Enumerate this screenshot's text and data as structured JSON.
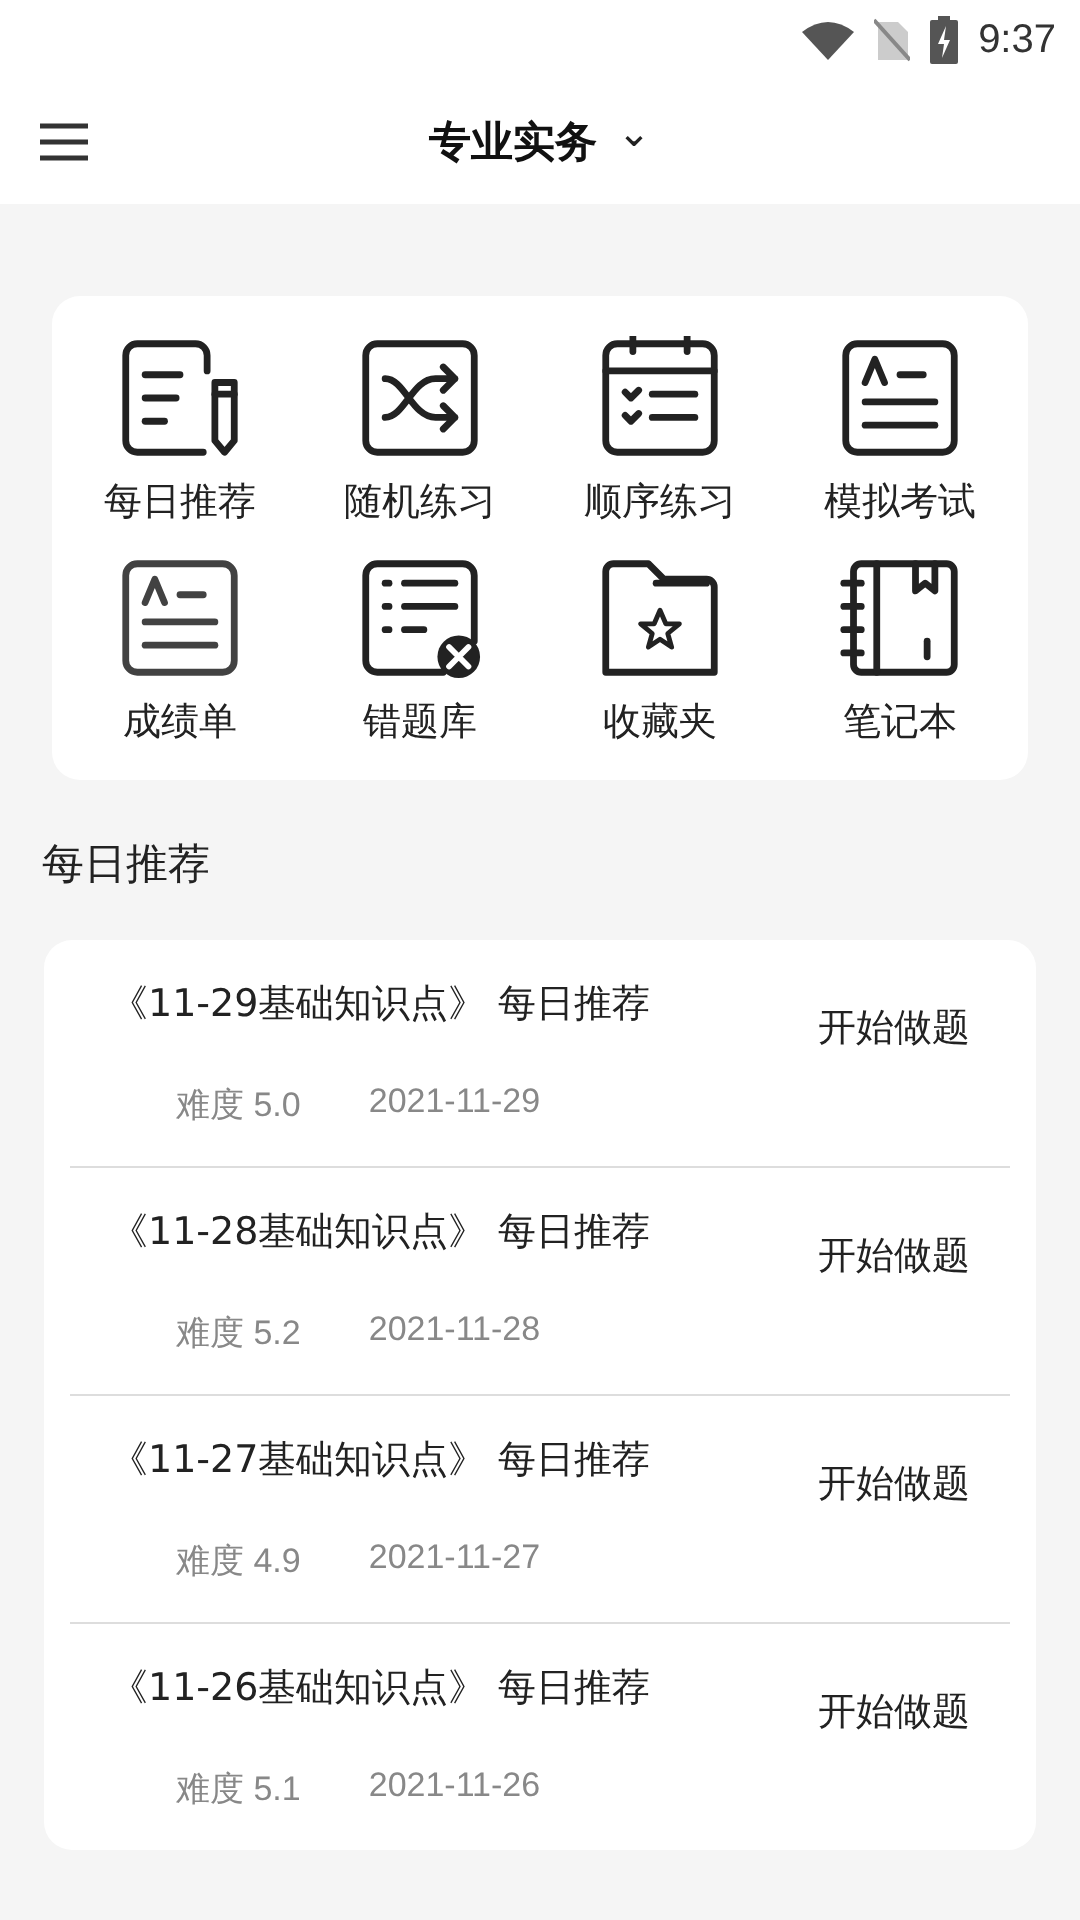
{
  "status_bar": {
    "time": "9:37"
  },
  "header": {
    "title": "专业实务",
    "dropdown": "⌄"
  },
  "features": [
    {
      "kind": "daily",
      "label": "每日推荐"
    },
    {
      "kind": "random",
      "label": "随机练习"
    },
    {
      "kind": "sequence",
      "label": "顺序练习"
    },
    {
      "kind": "exam",
      "label": "模拟考试"
    },
    {
      "kind": "score",
      "label": "成绩单"
    },
    {
      "kind": "wrong",
      "label": "错题库"
    },
    {
      "kind": "favorite",
      "label": "收藏夹"
    },
    {
      "kind": "notebook",
      "label": "笔记本"
    }
  ],
  "section_title": "每日推荐",
  "recommendations": [
    {
      "title": "《11-29基础知识点》 每日推荐",
      "difficulty": "难度 5.0",
      "date": "2021-11-29",
      "action": "开始做题"
    },
    {
      "title": "《11-28基础知识点》 每日推荐",
      "difficulty": "难度 5.2",
      "date": "2021-11-28",
      "action": "开始做题"
    },
    {
      "title": "《11-27基础知识点》 每日推荐",
      "difficulty": "难度 4.9",
      "date": "2021-11-27",
      "action": "开始做题"
    },
    {
      "title": "《11-26基础知识点》 每日推荐",
      "difficulty": "难度 5.1",
      "date": "2021-11-26",
      "action": "开始做题"
    }
  ]
}
